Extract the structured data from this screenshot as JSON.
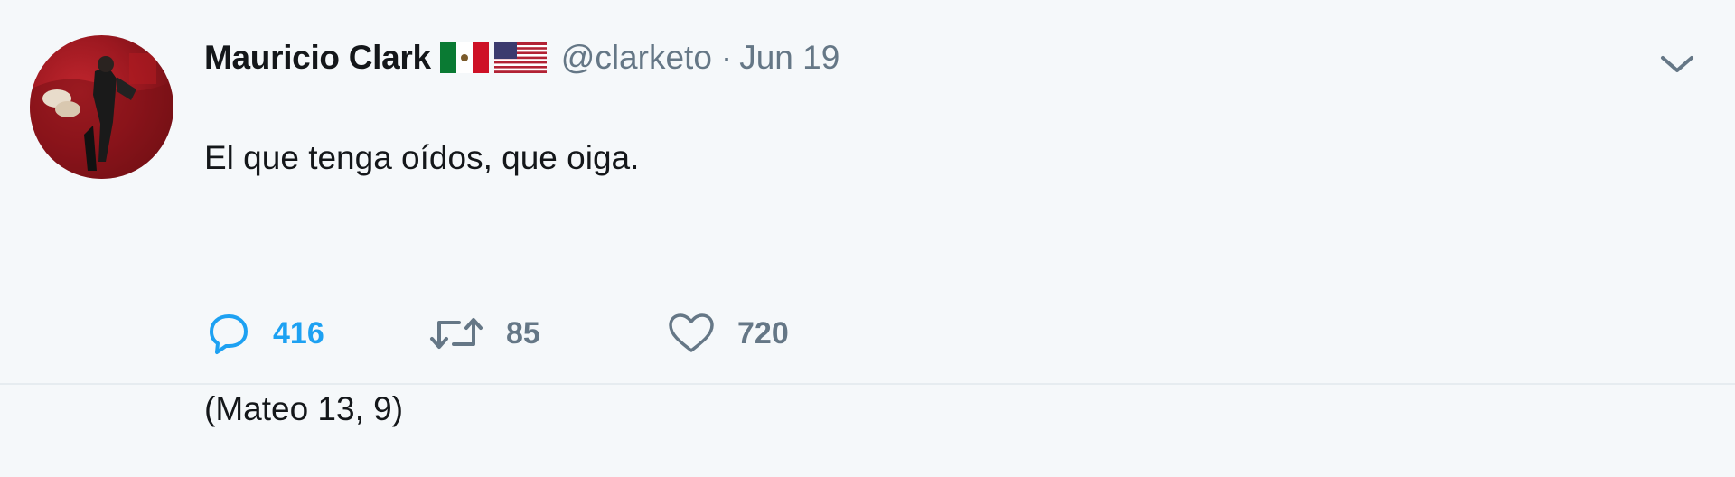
{
  "tweet": {
    "display_name": "Mauricio Clark",
    "flags": [
      "mexico-flag-icon",
      "usa-flag-icon"
    ],
    "handle": "@clarketo",
    "separator": "·",
    "date": "Jun 19",
    "text_line1": "El que tenga oídos, que oiga.",
    "text_line2": "(Mateo 13, 9)",
    "replies": "416",
    "retweets": "85",
    "likes": "720"
  },
  "colors": {
    "background": "#f5f8fa",
    "text": "#14171a",
    "secondary": "#657786",
    "accent": "#1da1f2"
  }
}
